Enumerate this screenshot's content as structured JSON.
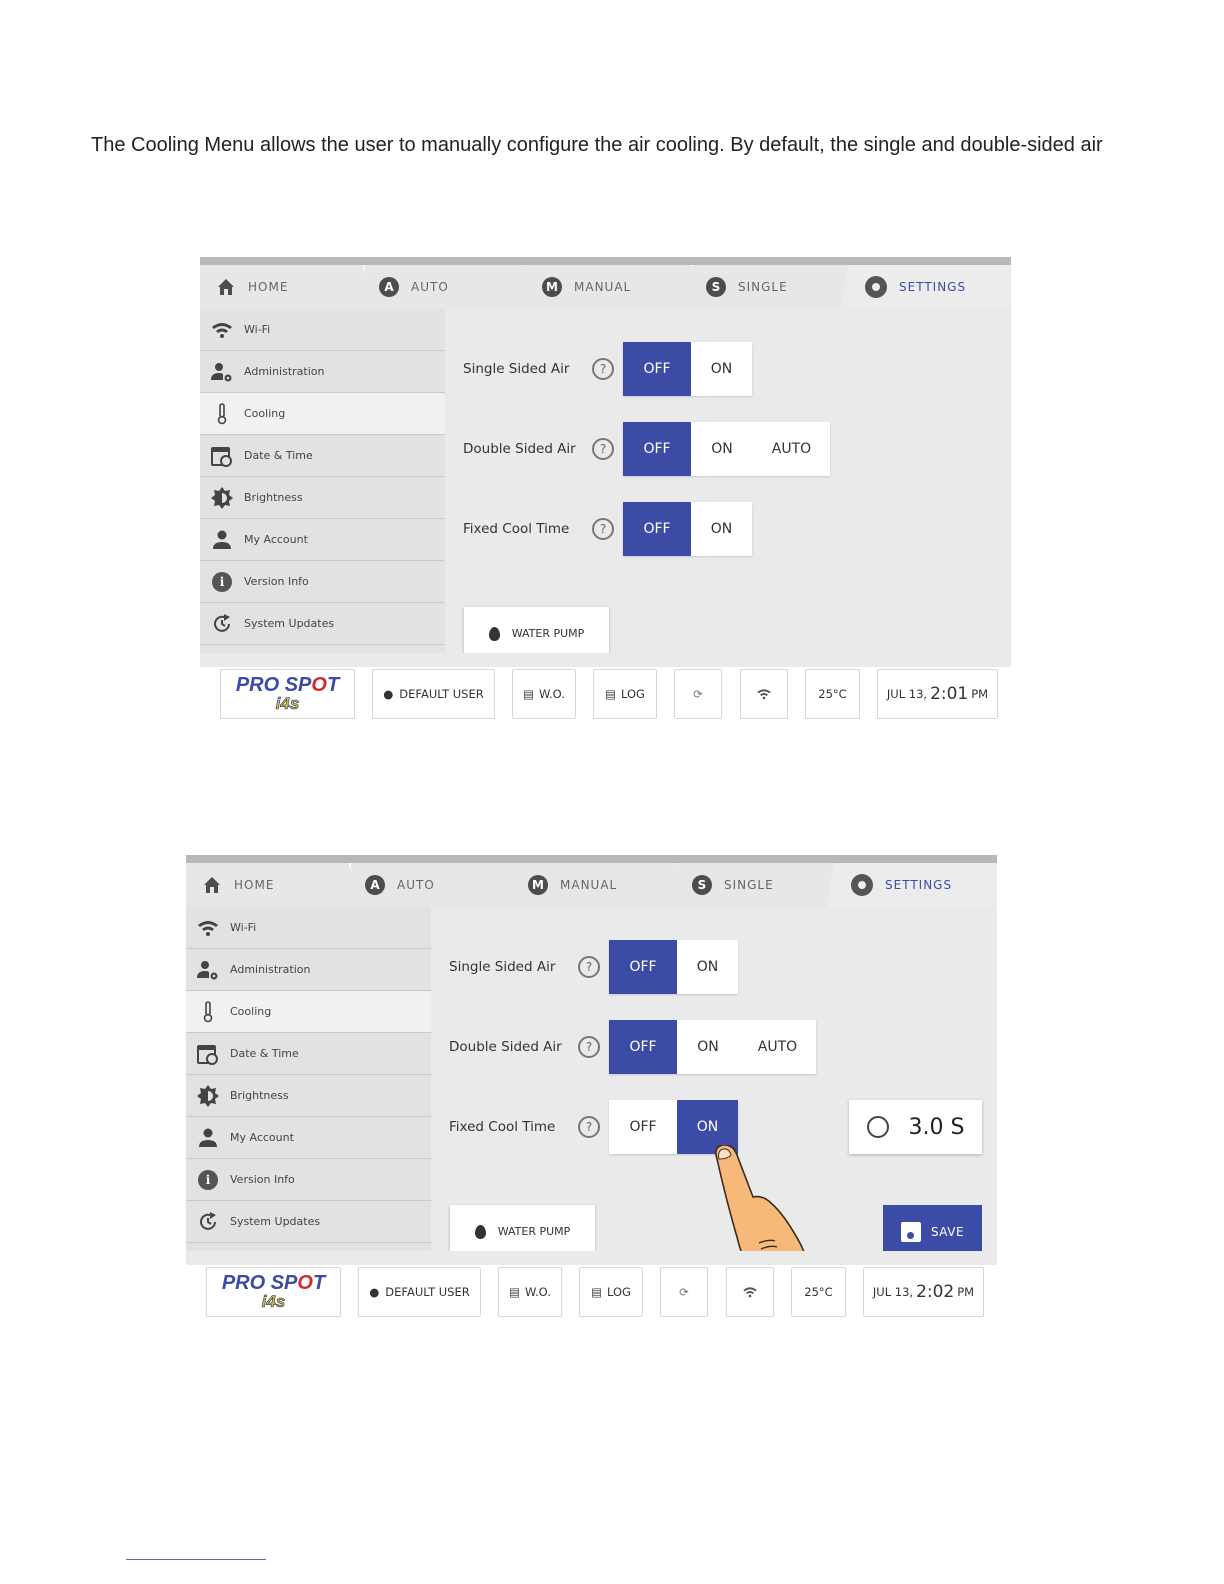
{
  "intro_text": "The Cooling Menu allows the user to manually configure the air cooling. By default, the single and double-sided air",
  "tabs": {
    "home": "HOME",
    "auto": "AUTO",
    "auto_letter": "A",
    "manual": "MANUAL",
    "manual_letter": "M",
    "single": "SINGLE",
    "single_letter": "S",
    "settings": "SETTINGS"
  },
  "sidebar": {
    "wifi": "Wi-Fi",
    "administration": "Administration",
    "cooling": "Cooling",
    "date_time": "Date & Time",
    "brightness": "Brightness",
    "my_account": "My Account",
    "version_info": "Version Info",
    "system_updates": "System Updates"
  },
  "settings": {
    "single_sided_air": "Single Sided Air",
    "double_sided_air": "Double Sided Air",
    "fixed_cool_time": "Fixed Cool Time",
    "help_glyph": "?",
    "off": "OFF",
    "on": "ON",
    "auto": "AUTO",
    "water_pump": "WATER PUMP",
    "save": "SAVE"
  },
  "screen1": {
    "single_sided_air_value": "OFF",
    "double_sided_air_value": "OFF",
    "fixed_cool_time_value": "OFF",
    "time_date": "JUL 13,",
    "time_clock": "2:01",
    "time_ampm": "PM"
  },
  "screen2": {
    "single_sided_air_value": "OFF",
    "double_sided_air_value": "OFF",
    "fixed_cool_time_value": "ON",
    "timer_value": "3.0 S",
    "time_date": "JUL 13,",
    "time_clock": "2:02",
    "time_ampm": "PM"
  },
  "status_bar": {
    "logo_line1_a": "PRO SP",
    "logo_line1_o": "O",
    "logo_line1_b": "T",
    "logo_line2": "i4s",
    "default_user": "DEFAULT USER",
    "wo": "W.O.",
    "log": "LOG",
    "temperature": "25°C"
  },
  "colors": {
    "accent": "#3b4ba6",
    "sidebar_bg": "#e2e2e2",
    "content_bg": "#eaeaea"
  }
}
